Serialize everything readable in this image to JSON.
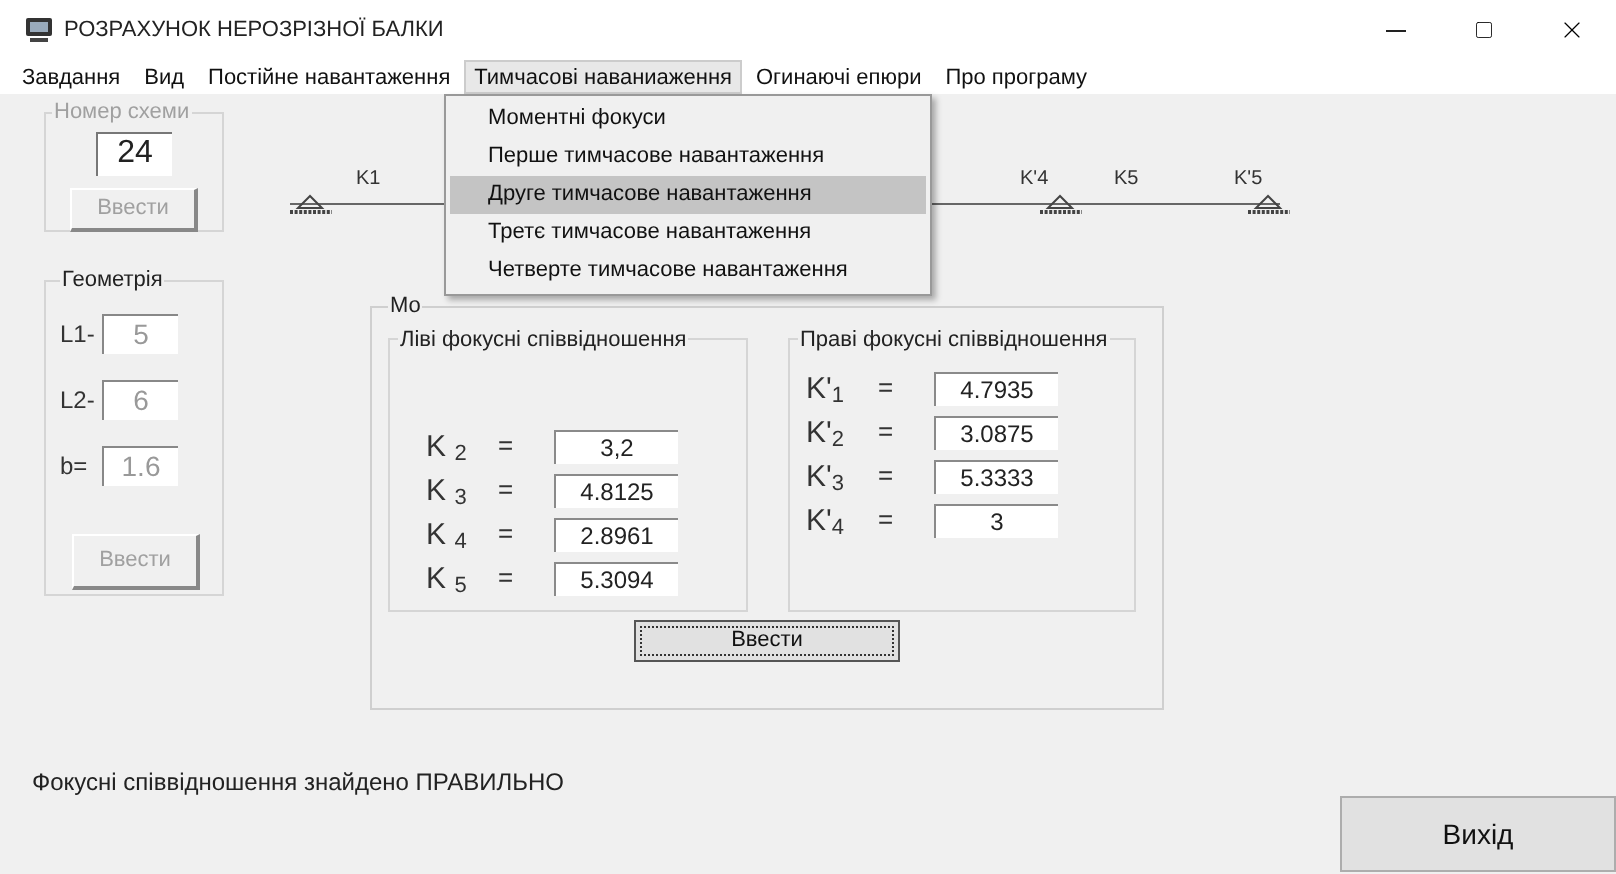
{
  "window": {
    "title": "РОЗРАХУНОК НЕРОЗРІЗНОЇ БАЛКИ"
  },
  "menu": [
    {
      "label": "Завдання",
      "selected": false
    },
    {
      "label": "Вид",
      "selected": false
    },
    {
      "label": "Постійне навантаження",
      "selected": false
    },
    {
      "label": "Тимчасові наваниаження",
      "selected": true
    },
    {
      "label": "Огинаючі епюри",
      "selected": false
    },
    {
      "label": "Про програму",
      "selected": false
    }
  ],
  "dropdown": [
    {
      "label": "Моментні фокуси",
      "selected": false
    },
    {
      "label": "Перше тимчасове навантаження",
      "selected": false
    },
    {
      "label": "Друге тимчасове навантаження",
      "selected": true
    },
    {
      "label": "Третє тимчасове навантаження",
      "selected": false
    },
    {
      "label": "Четверте тимчасове навантаження",
      "selected": false
    }
  ],
  "scheme_group": {
    "title": "Номер схеми",
    "value": "24",
    "button": "Ввести",
    "disabled": true
  },
  "geometry": {
    "title": "Геометрія",
    "disabled": true,
    "button": "Ввести",
    "fields": [
      {
        "label": "L1-",
        "value": "5"
      },
      {
        "label": "L2-",
        "value": "6"
      },
      {
        "label": "b=",
        "value": "1.6"
      }
    ]
  },
  "beam": {
    "labels": [
      "K1",
      "K'4",
      "K5",
      "K'5"
    ]
  },
  "moments": {
    "title": "Мо",
    "button": "Ввести",
    "left": {
      "title": "Ліві фокусні співвідношення",
      "rows": [
        {
          "label": "K $_{2}$",
          "sign": "=",
          "value": "3,2"
        },
        {
          "label": "K $_{3}$",
          "sign": "=",
          "value": "4.8125"
        },
        {
          "label": "K $_{4}$",
          "sign": "=",
          "value": "2.8961"
        },
        {
          "label": "K $_{5}$",
          "sign": "=",
          "value": "5.3094"
        }
      ]
    },
    "right": {
      "title": "Праві фокусні співвідношення",
      "rows": [
        {
          "label": "K'$_{1}$",
          "sign": "=",
          "value": "4.7935"
        },
        {
          "label": "K'$_{2}$",
          "sign": "=",
          "value": "3.0875"
        },
        {
          "label": "K'$_{3}$",
          "sign": "=",
          "value": "5.3333"
        },
        {
          "label": "K'$_{4}$",
          "sign": "=",
          "value": "3"
        }
      ]
    }
  },
  "status": "Фокусні співвідношення знайдено ПРАВИЛЬНО",
  "exit_button": "Вихід"
}
